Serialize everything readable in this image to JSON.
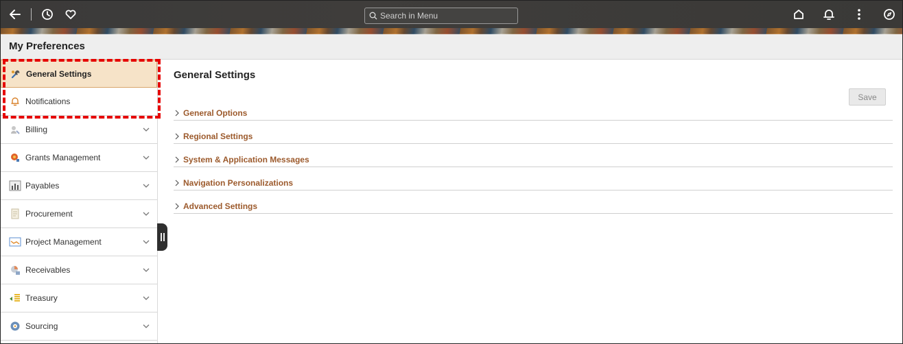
{
  "header": {
    "search_placeholder": "Search in Menu"
  },
  "page": {
    "title": "My Preferences"
  },
  "sidebar": {
    "items": [
      {
        "label": "General Settings",
        "icon": "tools-icon",
        "active": true
      },
      {
        "label": "Notifications",
        "icon": "bell-icon"
      },
      {
        "label": "Billing",
        "icon": "billing-icon"
      },
      {
        "label": "Grants Management",
        "icon": "grants-icon"
      },
      {
        "label": "Payables",
        "icon": "payables-icon"
      },
      {
        "label": "Procurement",
        "icon": "procurement-icon"
      },
      {
        "label": "Project Management",
        "icon": "project-icon"
      },
      {
        "label": "Receivables",
        "icon": "receivables-icon"
      },
      {
        "label": "Treasury",
        "icon": "treasury-icon"
      },
      {
        "label": "Sourcing",
        "icon": "sourcing-icon"
      }
    ]
  },
  "main": {
    "title": "General Settings",
    "save_label": "Save",
    "sections": [
      {
        "label": "General Options"
      },
      {
        "label": "Regional Settings"
      },
      {
        "label": "System & Application Messages"
      },
      {
        "label": "Navigation Personalizations"
      },
      {
        "label": "Advanced Settings"
      }
    ]
  },
  "colors": {
    "accent": "#9c5a2c",
    "active_bg": "#f6e3c8",
    "highlight": "#e60000"
  }
}
